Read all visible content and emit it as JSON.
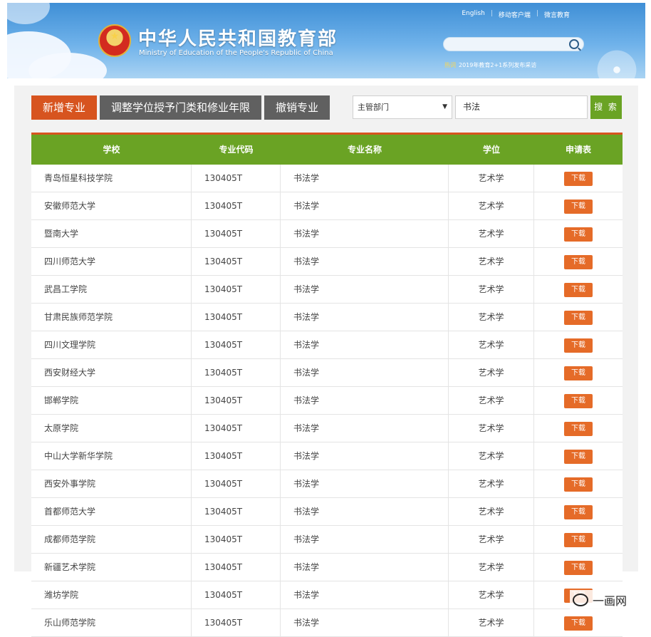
{
  "header": {
    "title": "中华人民共和国教育部",
    "subtitle": "Ministry of Education of the People's Republic of China",
    "links": [
      "English",
      "移动客户端",
      "微言教育"
    ],
    "hotline_label": "热词",
    "hotline_text": "2019年教育2+1系列发布采访"
  },
  "tabs": [
    {
      "label": "新增专业",
      "active": true
    },
    {
      "label": "调整学位授予门类和修业年限",
      "active": false
    },
    {
      "label": "撤销专业",
      "active": false
    }
  ],
  "filter": {
    "department_selected": "主管部门",
    "keyword_value": "书法",
    "search_label": "搜 索"
  },
  "table": {
    "headers": [
      "学校",
      "专业代码",
      "专业名称",
      "学位",
      "申请表"
    ],
    "download_label": "下载",
    "rows": [
      {
        "school": "青岛恒星科技学院",
        "code": "130405T",
        "major": "书法学",
        "degree": "艺术学"
      },
      {
        "school": "安徽师范大学",
        "code": "130405T",
        "major": "书法学",
        "degree": "艺术学"
      },
      {
        "school": "暨南大学",
        "code": "130405T",
        "major": "书法学",
        "degree": "艺术学"
      },
      {
        "school": "四川师范大学",
        "code": "130405T",
        "major": "书法学",
        "degree": "艺术学"
      },
      {
        "school": "武昌工学院",
        "code": "130405T",
        "major": "书法学",
        "degree": "艺术学"
      },
      {
        "school": "甘肃民族师范学院",
        "code": "130405T",
        "major": "书法学",
        "degree": "艺术学"
      },
      {
        "school": "四川文理学院",
        "code": "130405T",
        "major": "书法学",
        "degree": "艺术学"
      },
      {
        "school": "西安财经大学",
        "code": "130405T",
        "major": "书法学",
        "degree": "艺术学"
      },
      {
        "school": "邯郸学院",
        "code": "130405T",
        "major": "书法学",
        "degree": "艺术学"
      },
      {
        "school": "太原学院",
        "code": "130405T",
        "major": "书法学",
        "degree": "艺术学"
      },
      {
        "school": "中山大学新华学院",
        "code": "130405T",
        "major": "书法学",
        "degree": "艺术学"
      },
      {
        "school": "西安外事学院",
        "code": "130405T",
        "major": "书法学",
        "degree": "艺术学"
      },
      {
        "school": "首都师范大学",
        "code": "130405T",
        "major": "书法学",
        "degree": "艺术学"
      },
      {
        "school": "成都师范学院",
        "code": "130405T",
        "major": "书法学",
        "degree": "艺术学"
      },
      {
        "school": "新疆艺术学院",
        "code": "130405T",
        "major": "书法学",
        "degree": "艺术学"
      },
      {
        "school": "潍坊学院",
        "code": "130405T",
        "major": "书法学",
        "degree": "艺术学"
      },
      {
        "school": "乐山师范学院",
        "code": "130405T",
        "major": "书法学",
        "degree": "艺术学"
      }
    ]
  },
  "watermark": "一画网",
  "colors": {
    "tab_active": "#d7541f",
    "tab_normal": "#606060",
    "header_green": "#6aa324",
    "download": "#e56b28"
  }
}
